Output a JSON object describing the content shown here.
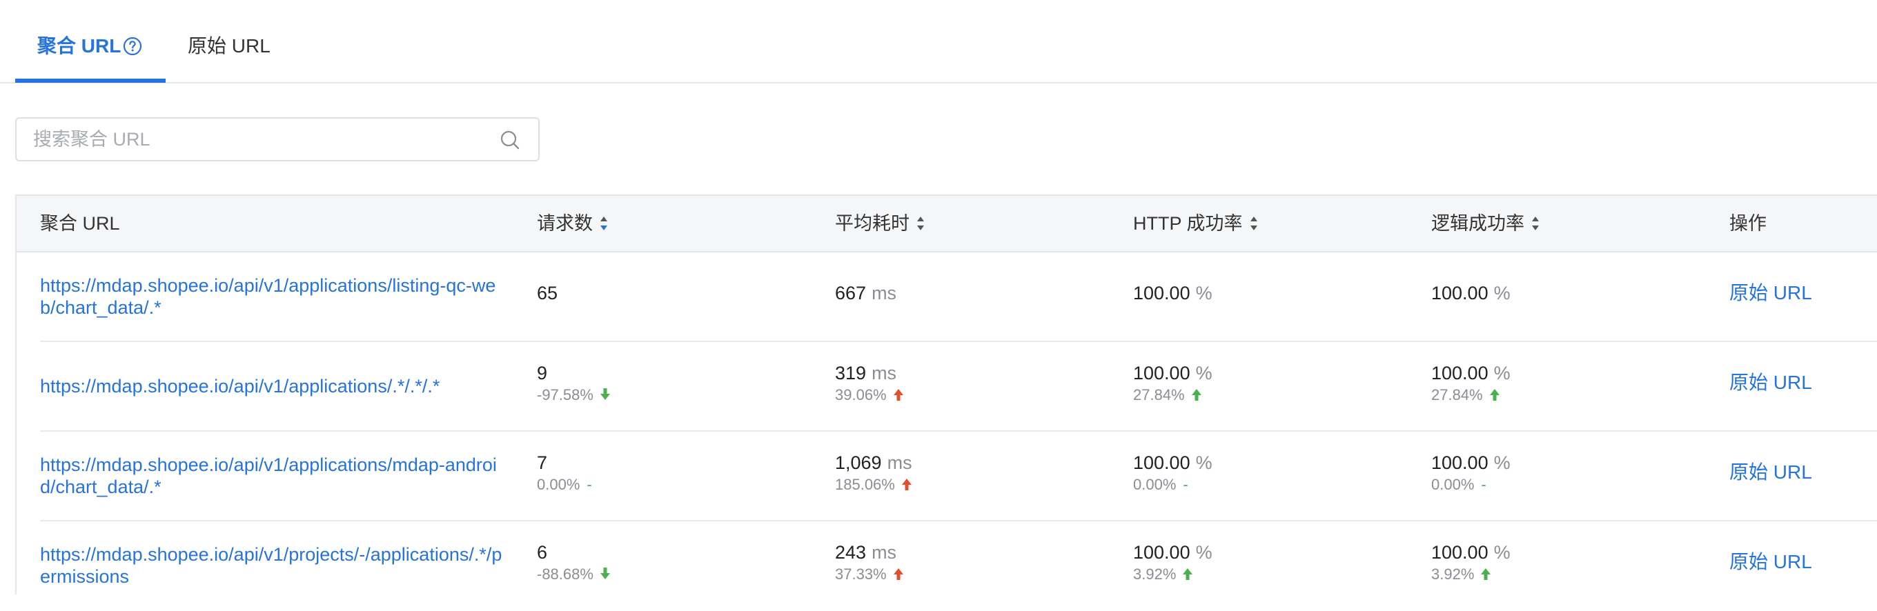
{
  "tabs": {
    "aggregate_label": "聚合 URL",
    "raw_label": "原始 URL"
  },
  "search": {
    "placeholder": "搜索聚合 URL",
    "value": ""
  },
  "table": {
    "columns": {
      "url": "聚合 URL",
      "requests": "请求数",
      "avg_time": "平均耗时",
      "http_rate": "HTTP 成功率",
      "logic_rate": "逻辑成功率",
      "actions": "操作"
    },
    "rows": [
      {
        "url": "https://mdap.shopee.io/api/v1/applications/listing-qc-web/chart_data/.*",
        "requests": "65",
        "requests_delta": "",
        "avg_time": "667",
        "avg_time_unit": "ms",
        "avg_time_delta": "",
        "http_rate": "100.00",
        "http_unit": "%",
        "http_delta": "",
        "logic_rate": "100.00",
        "logic_unit": "%",
        "logic_delta": "",
        "action": "原始 URL"
      },
      {
        "url": "https://mdap.shopee.io/api/v1/applications/.*/.*/.*",
        "requests": "9",
        "requests_delta": "-97.58%",
        "avg_time": "319",
        "avg_time_unit": "ms",
        "avg_time_delta": "39.06%",
        "http_rate": "100.00",
        "http_unit": "%",
        "http_delta": "27.84%",
        "logic_rate": "100.00",
        "logic_unit": "%",
        "logic_delta": "27.84%",
        "action": "原始 URL"
      },
      {
        "url": "https://mdap.shopee.io/api/v1/applications/mdap-android/chart_data/.*",
        "requests": "7",
        "requests_delta": "0.00%",
        "avg_time": "1,069",
        "avg_time_unit": "ms",
        "avg_time_delta": "185.06%",
        "http_rate": "100.00",
        "http_unit": "%",
        "http_delta": "0.00%",
        "logic_rate": "100.00",
        "logic_unit": "%",
        "logic_delta": "0.00%",
        "action": "原始 URL"
      },
      {
        "url": "https://mdap.shopee.io/api/v1/projects/-/applications/.*/permissions",
        "requests": "6",
        "requests_delta": "-88.68%",
        "avg_time": "243",
        "avg_time_unit": "ms",
        "avg_time_delta": "37.33%",
        "http_rate": "100.00",
        "http_unit": "%",
        "http_delta": "3.92%",
        "logic_rate": "100.00",
        "logic_unit": "%",
        "logic_delta": "3.92%",
        "action": "原始 URL"
      }
    ],
    "trend_dash": "-"
  },
  "colors": {
    "accent": "#2673dd",
    "up_red": "#e0502a",
    "down_green": "#4caf50",
    "text": "#333333",
    "muted": "#8a8d94"
  },
  "icons": {
    "help": "question-circle-icon",
    "search": "search-icon",
    "sort": "sort-caret-icon",
    "trend_up": "arrow-up-icon",
    "trend_down": "arrow-down-icon"
  }
}
